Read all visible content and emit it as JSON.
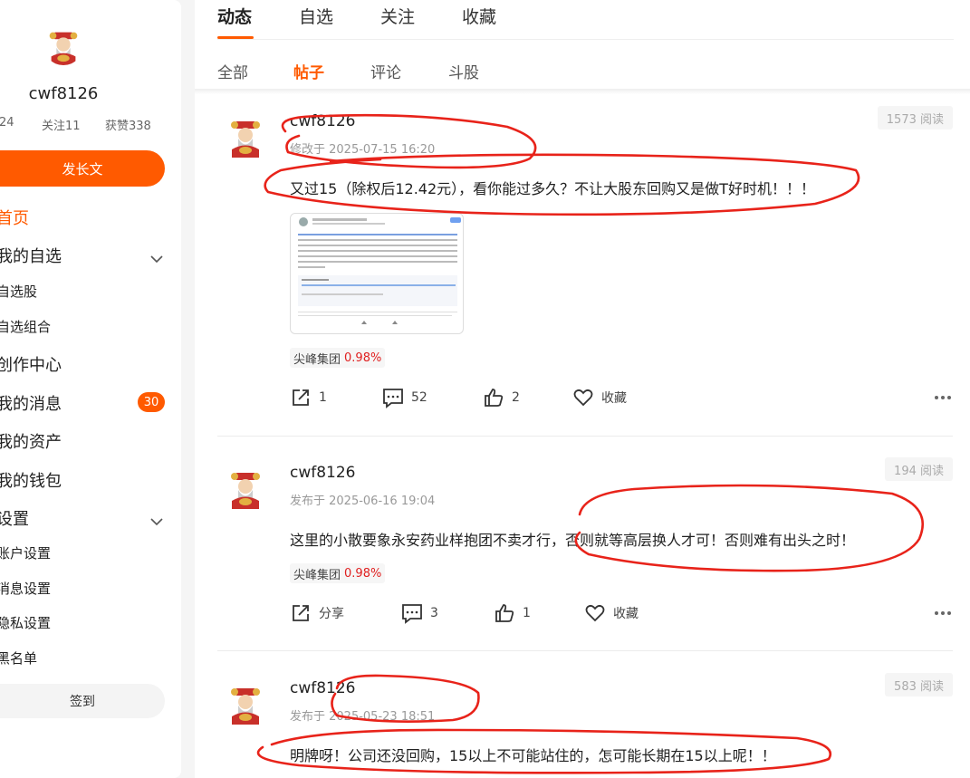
{
  "sidebar": {
    "username": "cwf8126",
    "stats": {
      "fans_fragment": "24",
      "follow": "关注11",
      "likes": "获赞338"
    },
    "post_button": "发长文",
    "nav": {
      "home": "首页",
      "watchlist": "我的自选",
      "watch_stocks": "自选股",
      "watch_groups": "自选组合",
      "creator": "创作中心",
      "messages": "我的消息",
      "messages_badge": "30",
      "assets": "我的资产",
      "wallet": "我的钱包",
      "settings": "设置",
      "account_settings": "账户设置",
      "message_settings": "消息设置",
      "privacy_settings": "隐私设置",
      "blacklist": "黑名单"
    },
    "signin_button": "签到"
  },
  "tabs": [
    "动态",
    "自选",
    "关注",
    "收藏"
  ],
  "subtabs": [
    "全部",
    "帖子",
    "评论",
    "斗股"
  ],
  "posts": [
    {
      "user": "cwf8126",
      "time": "修改于 2025-07-15 16:20",
      "views": "1573 阅读",
      "text": "又过15（除权后12.42元），看你能过多久？不让大股东回购又是做T好时机！！！",
      "stock_name": "尖峰集团",
      "stock_change": "0.98%",
      "share": "1",
      "comments": "52",
      "likes": "2",
      "collect": "收藏"
    },
    {
      "user": "cwf8126",
      "time": "发布于 2025-06-16 19:04",
      "views": "194 阅读",
      "text": "这里的小散要象永安药业样抱团不卖才行，否则就等高层换人才可！否则难有出头之时！",
      "stock_name": "尖峰集团",
      "stock_change": "0.98%",
      "share": "分享",
      "comments": "3",
      "likes": "1",
      "collect": "收藏"
    },
    {
      "user": "cwf8126",
      "time": "发布于 2025-05-23 18:51",
      "views": "583 阅读",
      "text": "明牌呀！公司还没回购，15以上不可能站住的，怎可能长期在15以上呢！！"
    }
  ],
  "colors": {
    "accent": "#ff5a00",
    "up": "#e02020",
    "scribble": "#e8231a"
  }
}
